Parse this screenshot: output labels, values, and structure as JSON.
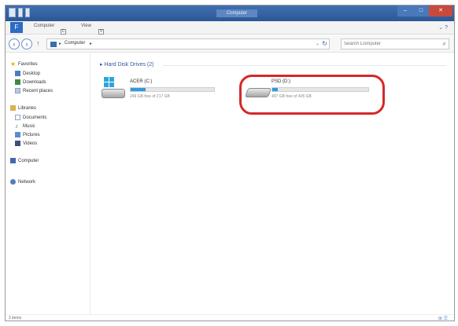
{
  "window": {
    "title": "Computer",
    "caption": {
      "minimize": "–",
      "maximize": "□",
      "close": "✕"
    }
  },
  "ribbon": {
    "file_tab": "F",
    "tabs": [
      "Computer",
      "View"
    ],
    "keytips": [
      "C",
      "V"
    ],
    "right_icons": "⌄ ?"
  },
  "address_bar": {
    "back": "‹",
    "forward": "›",
    "up": "↑",
    "separator": "▸",
    "crumb": "Computer",
    "crumb_arrow": "▸",
    "dropdown": "⌄",
    "refresh": "↻",
    "search_placeholder": "Search Computer",
    "search_icon": "⌕"
  },
  "nav_pane": {
    "favorites": {
      "label": "Favorites",
      "items": [
        "Desktop",
        "Downloads",
        "Recent places"
      ]
    },
    "libraries": {
      "label": "Libraries",
      "items": [
        "Documents",
        "Music",
        "Pictures",
        "Videos"
      ]
    },
    "computer": "Computer",
    "network": "Network"
  },
  "content": {
    "group_header": "▸ Hard Disk Drives (2)",
    "drives": [
      {
        "name": "ACER (C:)",
        "free_text": "249 GB free of 217 GB",
        "used_fraction": 0.18,
        "icon": "windows-drive-icon"
      },
      {
        "name": "PSD (D:)",
        "free_text": "407 GB free of 405 GB",
        "used_fraction": 0.06,
        "icon": "hard-drive-icon"
      }
    ]
  },
  "status_bar": {
    "items_text": "2 items",
    "view_icons": "⊞ ☰"
  },
  "colors": {
    "accent": "#2d6bc4",
    "highlight_ring": "#d62828",
    "drive_bar_fill": "#2d9be0"
  }
}
